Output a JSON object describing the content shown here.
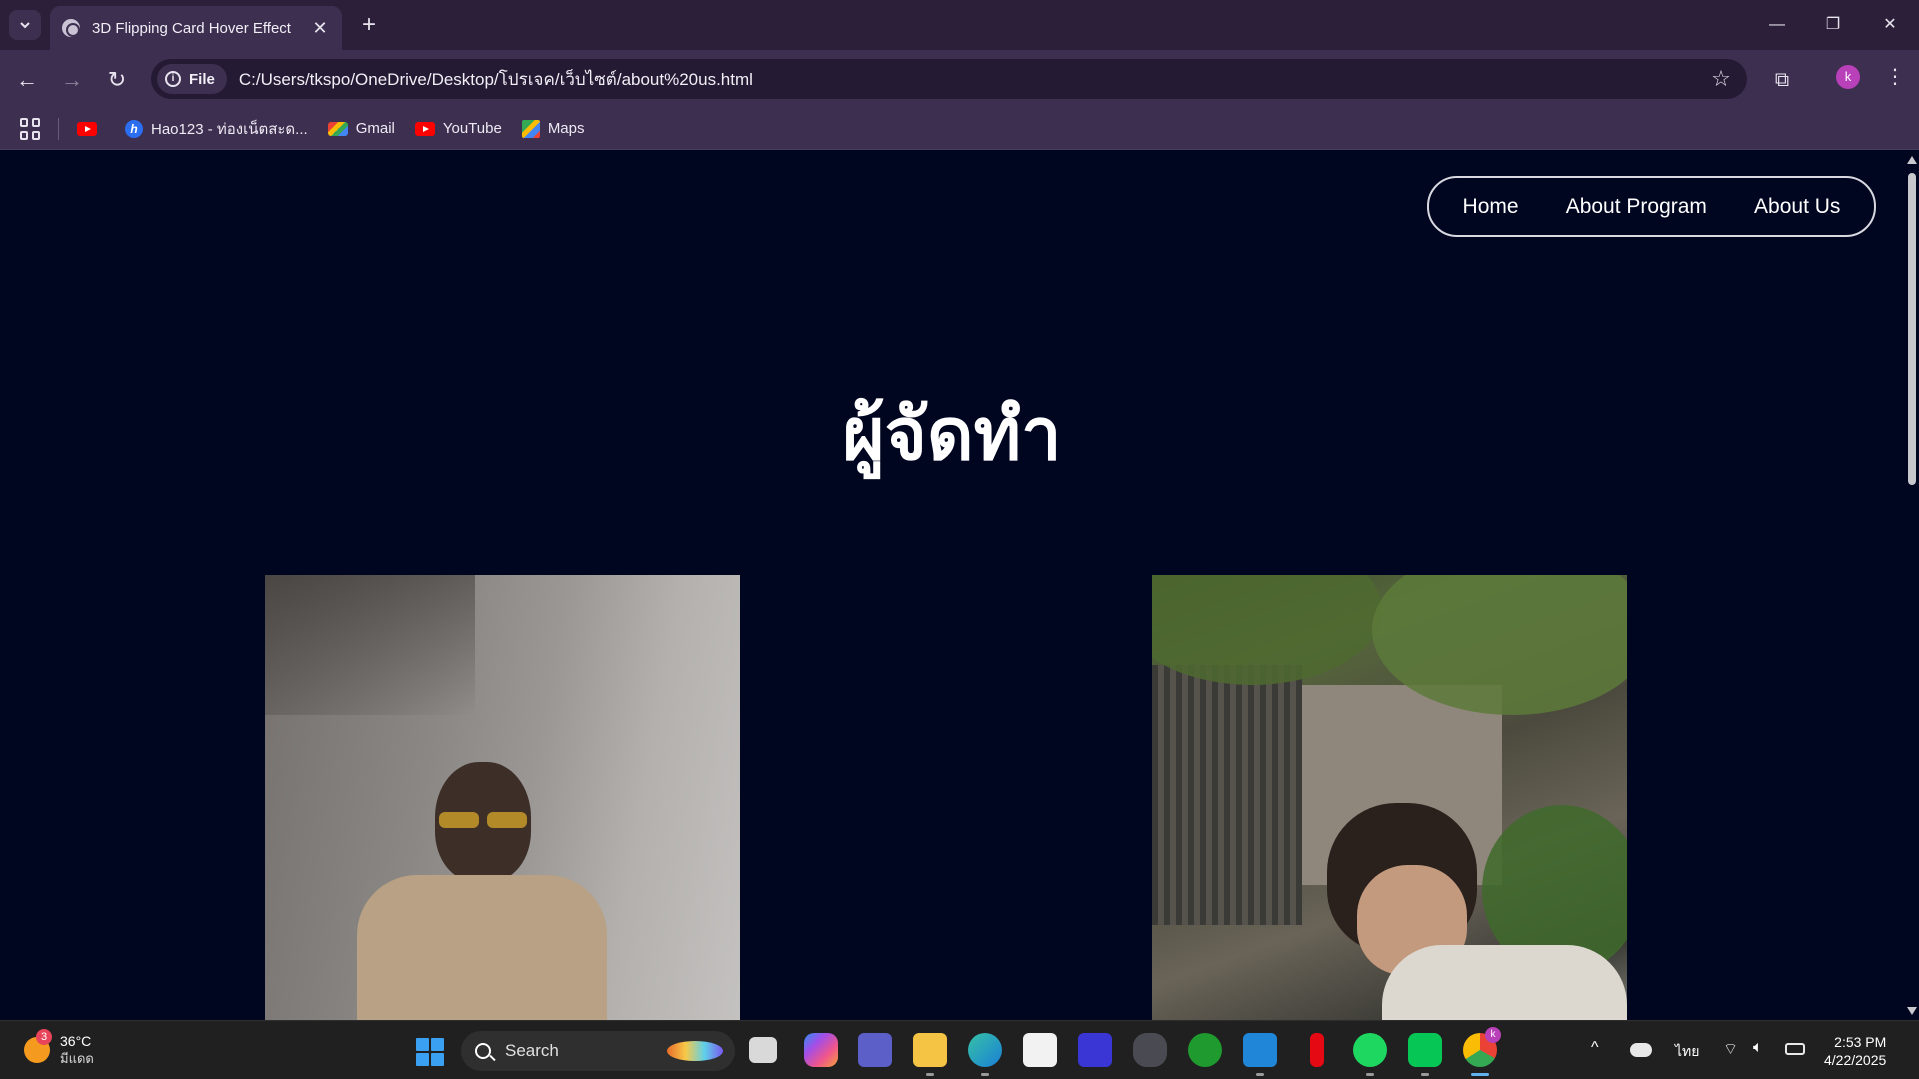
{
  "browser": {
    "tab_title": "3D Flipping Card Hover Effect",
    "address_chip": "File",
    "url": "C:/Users/tkspo/OneDrive/Desktop/โปรเจค/เว็บไซต์/about%20us.html",
    "profile_initial": "k",
    "bookmarks": [
      {
        "label": "",
        "icon": "youtube-icon"
      },
      {
        "label": "Hao123 - ท่องเน็ตสะด...",
        "icon": "hao123-icon"
      },
      {
        "label": "Gmail",
        "icon": "gmail-icon"
      },
      {
        "label": "YouTube",
        "icon": "youtube-icon"
      },
      {
        "label": "Maps",
        "icon": "maps-icon"
      }
    ]
  },
  "page": {
    "nav": {
      "home": "Home",
      "about_program": "About Program",
      "about_us": "About Us"
    },
    "title": "ผู้จัดทำ"
  },
  "taskbar": {
    "weather_temp": "36°C",
    "weather_desc": "มีแดด",
    "weather_badge": "3",
    "search_label": "Search",
    "language": "ไทย",
    "time": "2:53 PM",
    "date": "4/22/2025",
    "chrome_badge": "k"
  },
  "colors": {
    "page_background": "#000520",
    "chrome_frame": "#2b1f3a",
    "chrome_toolbar": "#3d2f50",
    "taskbar": "#202020"
  }
}
